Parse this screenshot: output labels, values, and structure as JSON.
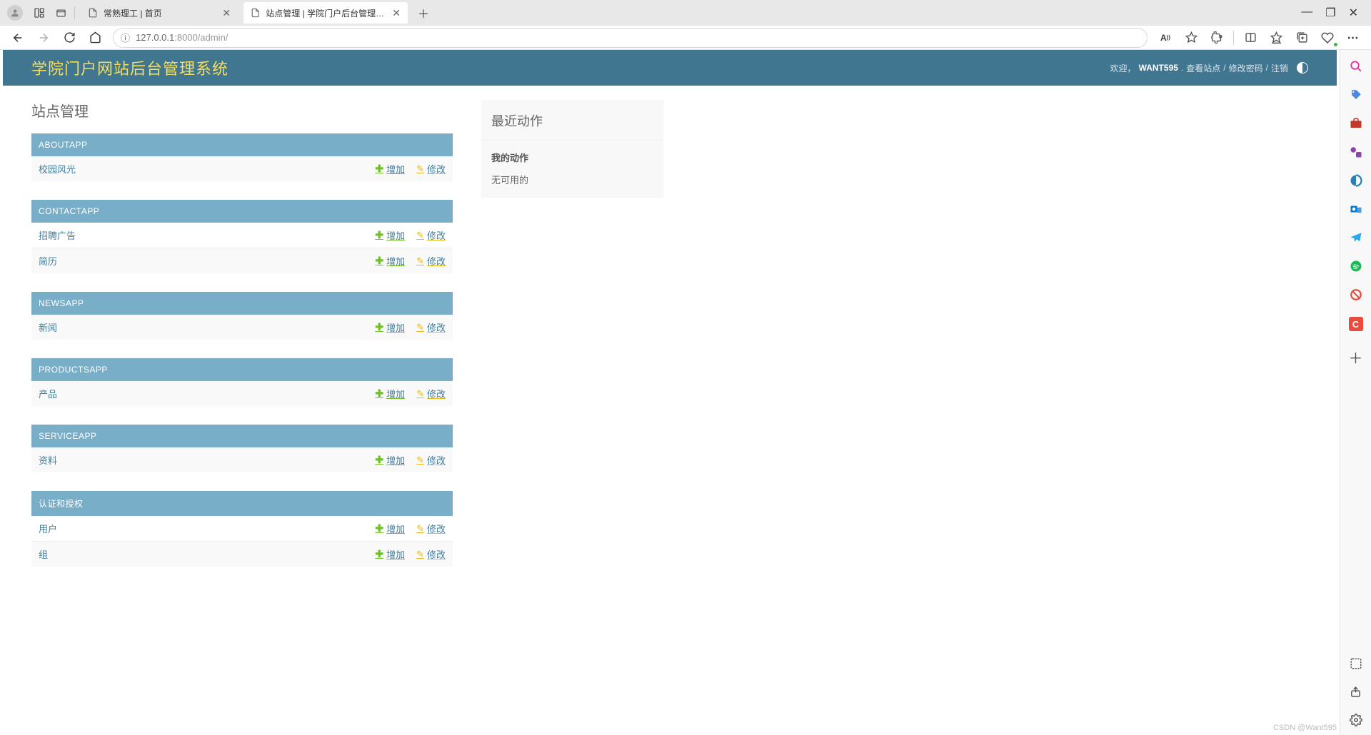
{
  "browser": {
    "tabs": [
      {
        "title": "常熟理工 | 首页",
        "active": false
      },
      {
        "title": "站点管理 | 学院门户后台管理系统",
        "active": true
      }
    ],
    "url_host": "127.0.0.1",
    "url_port": ":8000",
    "url_path": "/admin/",
    "win": {
      "minimize": "—",
      "maximize": "❐",
      "close": "✕"
    }
  },
  "header": {
    "site_title": "学院门户网站后台管理系统",
    "welcome": "欢迎，",
    "username": "WANT595",
    "view_site": "查看站点",
    "change_password": "修改密码",
    "logout": "注销"
  },
  "page": {
    "title": "站点管理",
    "add_label": "增加",
    "change_label": "修改",
    "apps": [
      {
        "name": "ABOUTAPP",
        "models": [
          {
            "name": "校园风光"
          }
        ]
      },
      {
        "name": "CONTACTAPP",
        "models": [
          {
            "name": "招聘广告"
          },
          {
            "name": "简历"
          }
        ]
      },
      {
        "name": "NEWSAPP",
        "models": [
          {
            "name": "新闻"
          }
        ]
      },
      {
        "name": "PRODUCTSAPP",
        "models": [
          {
            "name": "产品"
          }
        ]
      },
      {
        "name": "SERVICEAPP",
        "models": [
          {
            "name": "资料"
          }
        ]
      },
      {
        "name": "认证和授权",
        "models": [
          {
            "name": "用户"
          },
          {
            "name": "组"
          }
        ]
      }
    ]
  },
  "recent": {
    "title": "最近动作",
    "subtitle": "我的动作",
    "empty": "无可用的"
  },
  "watermark": "CSDN @Want595"
}
